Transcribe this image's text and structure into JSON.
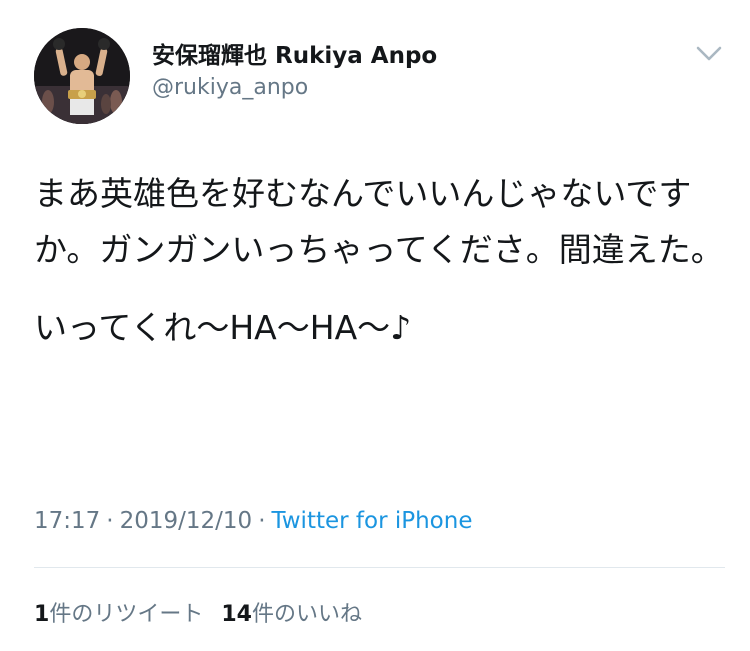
{
  "author": {
    "display_name": "安保瑠輝也 Rukiya Anpo",
    "handle": "@rukiya_anpo",
    "avatar_icon": "profile-photo"
  },
  "tweet": {
    "paragraphs": [
      "まあ英雄色を好むなんでいいんじゃないですか。ガンガンいっちゃってくださ。間違えた。",
      "いってくれ〜HA〜HA〜♪"
    ],
    "time": "17:17",
    "separator": "·",
    "date": "2019/12/10",
    "source": "Twitter for iPhone"
  },
  "stats": {
    "retweets_count": "1",
    "retweets_label": "件のリツイート",
    "likes_count": "14",
    "likes_label": "件のいいね"
  },
  "colors": {
    "text": "#14171a",
    "secondary": "#657786",
    "link": "#1b95e0",
    "divider": "#e1e8ed",
    "caret": "#aab8c2"
  }
}
